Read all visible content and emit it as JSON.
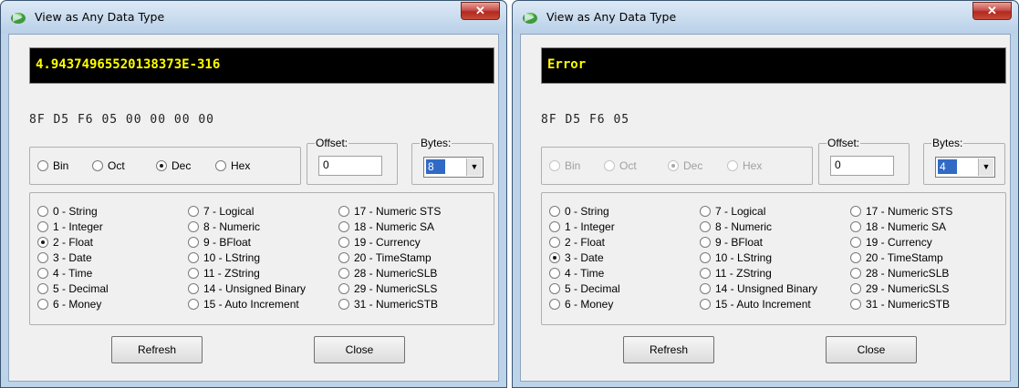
{
  "windows": [
    {
      "title": "View as Any Data Type",
      "close_glyph": "✕",
      "display_value": "4.94374965520138373E-316",
      "hex_bytes": "8F D5 F6 05 00 00 00 00",
      "radix": {
        "enabled": true,
        "options": [
          "Bin",
          "Oct",
          "Dec",
          "Hex"
        ],
        "selected": "Dec"
      },
      "offset": {
        "label": "Offset:",
        "value": "0"
      },
      "bytes": {
        "label": "Bytes:",
        "value": "8"
      },
      "types": {
        "selected": "2 - Float",
        "col1": [
          "0 - String",
          "1 - Integer",
          "2 - Float",
          "3 - Date",
          "4 - Time",
          "5 - Decimal",
          "6 - Money"
        ],
        "col2": [
          "7 - Logical",
          "8 - Numeric",
          "9 - BFloat",
          "10 - LString",
          "11 - ZString",
          "14 - Unsigned Binary",
          "15 - Auto Increment"
        ],
        "col3": [
          "17 - Numeric STS",
          "18 - Numeric SA",
          "19 - Currency",
          "20 - TimeStamp",
          "28 - NumericSLB",
          "29 - NumericSLS",
          "31 - NumericSTB"
        ]
      },
      "buttons": {
        "refresh": "Refresh",
        "close": "Close"
      }
    },
    {
      "title": "View as Any Data Type",
      "close_glyph": "✕",
      "display_value": "Error",
      "hex_bytes": "8F D5 F6 05",
      "radix": {
        "enabled": false,
        "options": [
          "Bin",
          "Oct",
          "Dec",
          "Hex"
        ],
        "selected": "Dec"
      },
      "offset": {
        "label": "Offset:",
        "value": "0"
      },
      "bytes": {
        "label": "Bytes:",
        "value": "4"
      },
      "types": {
        "selected": "3 - Date",
        "col1": [
          "0 - String",
          "1 - Integer",
          "2 - Float",
          "3 - Date",
          "4 - Time",
          "5 - Decimal",
          "6 - Money"
        ],
        "col2": [
          "7 - Logical",
          "8 - Numeric",
          "9 - BFloat",
          "10 - LString",
          "11 - ZString",
          "14 - Unsigned Binary",
          "15 - Auto Increment"
        ],
        "col3": [
          "17 - Numeric STS",
          "18 - Numeric SA",
          "19 - Currency",
          "20 - TimeStamp",
          "28 - NumericSLB",
          "29 - NumericSLS",
          "31 - NumericSTB"
        ]
      },
      "buttons": {
        "refresh": "Refresh",
        "close": "Close"
      }
    }
  ]
}
